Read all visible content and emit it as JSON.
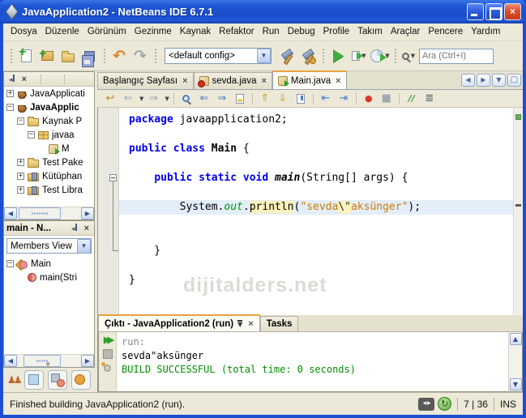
{
  "window": {
    "title": "JavaApplication2 - NetBeans IDE 6.7.1"
  },
  "menubar": [
    "Dosya",
    "Düzenle",
    "Görünüm",
    "Gezinme",
    "Kaynak",
    "Refaktor",
    "Run",
    "Debug",
    "Profile",
    "Takım",
    "Araçlar",
    "Pencere",
    "Yardım"
  ],
  "toolbar": {
    "config": "<default config>",
    "search_placeholder": "Ara (Ctrl+I)"
  },
  "tabs": [
    {
      "label": "Başlangıç Sayfası",
      "icon": "none",
      "active": false
    },
    {
      "label": "sevda.java",
      "icon": "class-error",
      "active": false
    },
    {
      "label": "Main.java",
      "icon": "class-main",
      "active": true
    }
  ],
  "projects": {
    "nodes": [
      {
        "label": "JavaApplicati",
        "level": 0,
        "expander": "+",
        "icon": "project",
        "bold": false
      },
      {
        "label": "JavaApplic",
        "level": 0,
        "expander": "-",
        "icon": "project",
        "bold": true
      },
      {
        "label": "Kaynak P",
        "level": 1,
        "expander": "-",
        "icon": "folder",
        "bold": false
      },
      {
        "label": "javaa",
        "level": 2,
        "expander": "-",
        "icon": "package",
        "bold": false
      },
      {
        "label": "M",
        "level": 3,
        "expander": "",
        "icon": "class-main",
        "bold": false
      },
      {
        "label": "Test Pake",
        "level": 1,
        "expander": "+",
        "icon": "folder",
        "bold": false
      },
      {
        "label": "Kütüphan",
        "level": 1,
        "expander": "+",
        "icon": "libs",
        "bold": false
      },
      {
        "label": "Test Libra",
        "level": 1,
        "expander": "+",
        "icon": "libs",
        "bold": false
      }
    ]
  },
  "navigator": {
    "title": "main - N...",
    "view": "Members View",
    "nodes": [
      {
        "label": "Main",
        "level": 0,
        "expander": "-",
        "icon": "class",
        "bold": false
      },
      {
        "label": "main(Stri",
        "level": 1,
        "expander": "",
        "icon": "method",
        "bold": false
      }
    ]
  },
  "editor": {
    "watermark": "dijitalders.net",
    "lines": [
      {
        "tokens": [
          {
            "t": "package",
            "c": "kw"
          },
          {
            "t": " javaapplication2;",
            "c": "pl"
          }
        ]
      },
      {
        "tokens": []
      },
      {
        "tokens": [
          {
            "t": "public class",
            "c": "kw"
          },
          {
            "t": " ",
            "c": "pl"
          },
          {
            "t": "Main",
            "c": "cls"
          },
          {
            "t": " {",
            "c": "pl"
          }
        ]
      },
      {
        "tokens": []
      },
      {
        "tokens": [
          {
            "t": "    ",
            "c": "pl"
          },
          {
            "t": "public static void",
            "c": "kw"
          },
          {
            "t": " ",
            "c": "pl"
          },
          {
            "t": "main",
            "c": "mtd"
          },
          {
            "t": "(String[] args) {",
            "c": "pl"
          }
        ]
      },
      {
        "tokens": []
      },
      {
        "tokens": [
          {
            "t": "        System.",
            "c": "pl"
          },
          {
            "t": "out",
            "c": "fld"
          },
          {
            "t": ".",
            "c": "pl"
          },
          {
            "t": "println",
            "c": "hl"
          },
          {
            "t": "(",
            "c": "pl"
          },
          {
            "t": "\"sevda",
            "c": "str"
          },
          {
            "t": "\\\"",
            "c": "esc"
          },
          {
            "t": "aksünger\"",
            "c": "str"
          },
          {
            "t": ");",
            "c": "pl"
          }
        ],
        "current": true
      },
      {
        "tokens": []
      },
      {
        "tokens": []
      },
      {
        "tokens": [
          {
            "t": "    }",
            "c": "pl"
          }
        ]
      },
      {
        "tokens": []
      },
      {
        "tokens": [
          {
            "t": "}",
            "c": "pl"
          }
        ]
      }
    ]
  },
  "output": {
    "tab": "Çıktı - JavaApplication2 (run)",
    "tasks_tab": "Tasks",
    "lines": [
      {
        "text": "run:",
        "c": "muted"
      },
      {
        "text": "sevda\"aksünger",
        "c": "plain"
      },
      {
        "text": "BUILD SUCCESSFUL (total time: 0 seconds)",
        "c": "success"
      }
    ]
  },
  "statusbar": {
    "message": "Finished building JavaApplication2 (run).",
    "position": "7 | 36",
    "mode": "INS"
  },
  "icons": {
    "close": "×",
    "collapse": "◂",
    "caret": "▼",
    "scroll_left": "◀",
    "scroll_right": "▶",
    "up": "▲",
    "down": "▼",
    "undo": "↶",
    "redo": "↷",
    "back": "⇐",
    "forward": "⇒",
    "find_prev": "⇐",
    "find_next": "⇒",
    "move_up": "⇑",
    "move_down": "⇓",
    "shift_left": "⇤",
    "shift_right": "⇥",
    "last_edit": "↩",
    "record": "●",
    "stop": "■",
    "comment": "//",
    "uncomment": "≣",
    "rerun": "▶▶",
    "gear": "⚙",
    "refresh": "↻",
    "caret_pair": "◂ ▸",
    "maximize": "□",
    "people": "♟♟",
    "handle": "▼"
  },
  "colors": {
    "accent_orange": "#e8a33d",
    "xp_blue": "#1c4fd0",
    "success_green": "#008f00",
    "keyword_blue": "#0000e6",
    "string_orange": "#ce7b00"
  }
}
